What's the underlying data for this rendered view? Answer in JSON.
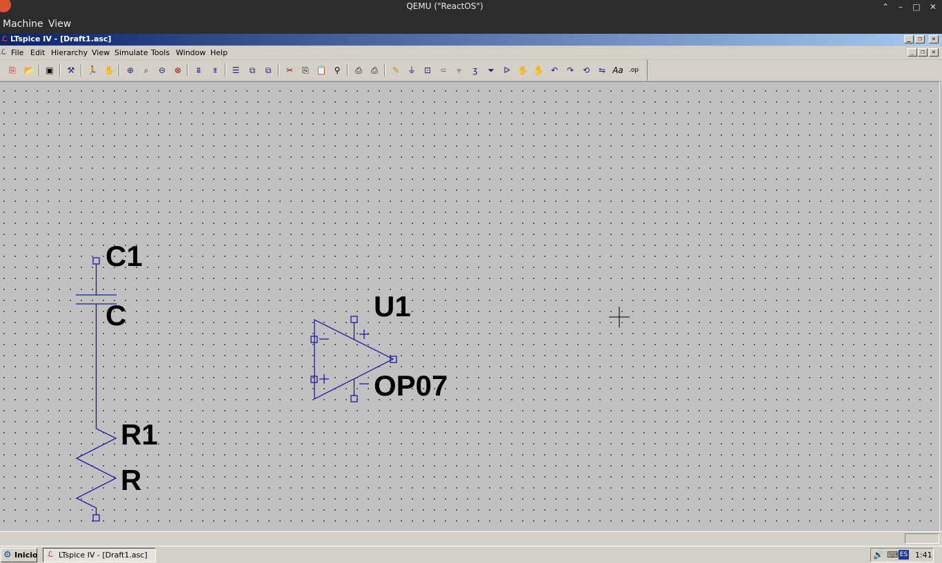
{
  "host": {
    "title": "QEMU (\"ReactOS\")",
    "menu": [
      "Machine",
      "View"
    ],
    "controls": {
      "up": "⌃",
      "minimize": "–",
      "maximize": "□",
      "close": "✕"
    }
  },
  "app": {
    "title": "LTspice IV - [Draft1.asc]",
    "menu": [
      {
        "label": "File"
      },
      {
        "label": "Edit"
      },
      {
        "label": "Hierarchy"
      },
      {
        "label": "View"
      },
      {
        "label": "Simulate"
      },
      {
        "label": "Tools"
      },
      {
        "label": "Window"
      },
      {
        "label": "Help"
      }
    ],
    "toolbar_icons": [
      "new-schematic-icon",
      "open-icon",
      "save-icon",
      "control-panel-icon",
      "run-icon",
      "halt-icon",
      "zoom-in-icon",
      "zoom-pan-icon",
      "zoom-out-icon",
      "zoom-fit-icon",
      "autoscale-icon",
      "view-icon",
      "tile-horizontal-icon",
      "tile-vertical-icon",
      "cascade-icon",
      "cut-icon",
      "copy-icon",
      "paste-icon",
      "find-icon",
      "print-setup-icon",
      "print-icon",
      "wire-icon",
      "ground-icon",
      "label-net-icon",
      "resistor-icon",
      "capacitor-icon",
      "inductor-icon",
      "diode-icon",
      "component-icon",
      "move-icon",
      "drag-icon",
      "undo-icon",
      "redo-icon",
      "rotate-icon",
      "mirror-icon",
      "text-icon",
      "spice-directive-icon"
    ]
  },
  "schematic": {
    "capacitor": {
      "name": "C1",
      "value": "C"
    },
    "resistor": {
      "name": "R1",
      "value": "R"
    },
    "opamp": {
      "name": "U1",
      "value": "OP07"
    }
  },
  "colors": {
    "wire": "#1a1aa0",
    "canvas": "#c0c0c0",
    "grid_dot": "#3d3d6a",
    "title_start": "#0a246a"
  },
  "taskbar": {
    "start_label": "Inicio",
    "task_label": "LTspice IV - [Draft1.asc]",
    "language": "ES",
    "clock": "1:41"
  }
}
